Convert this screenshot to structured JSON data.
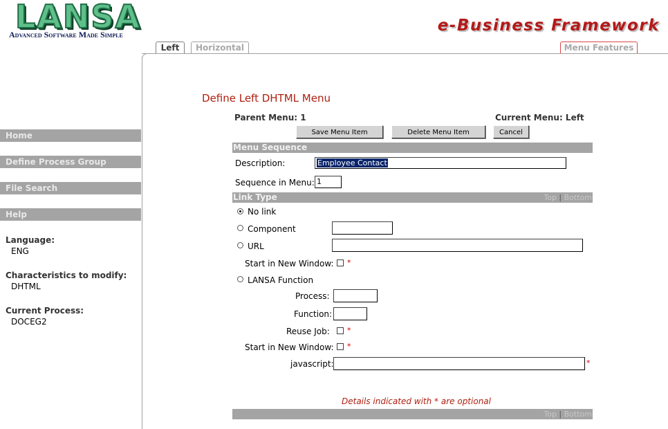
{
  "header": {
    "logo_text": "LANSA",
    "logo_tagline": "Advanced Software Made Simple",
    "brand": "e-Business Framework"
  },
  "tabs": [
    {
      "label": "Left",
      "active": true
    },
    {
      "label": "Horizontal",
      "active": false
    }
  ],
  "menu_features_tab": "Menu Features",
  "sidebar": {
    "nav": [
      "Home",
      "Define Process Group",
      "File Search",
      "Help"
    ],
    "language_label": "Language:",
    "language_value": "ENG",
    "characteristics_label": "Characteristics to modify:",
    "characteristics_value": "DHTML",
    "process_label": "Current Process:",
    "process_value": "DOCEG2"
  },
  "main": {
    "title": "Define Left DHTML Menu",
    "parent_menu": "Parent Menu: 1",
    "current_menu": "Current Menu: Left",
    "buttons": {
      "save": "Save Menu Item",
      "delete": "Delete Menu Item",
      "cancel": "Cancel"
    },
    "menu_sequence": {
      "header": "Menu Sequence",
      "description_label": "Description:",
      "description_value": "Employee Contact",
      "sequence_label": "Sequence in Menu:",
      "sequence_value": "1"
    },
    "link_type": {
      "header": "Link Type",
      "top": "Top",
      "sep": "|",
      "bottom": "Bottom",
      "no_link": "No link",
      "component": "Component",
      "url": "URL",
      "new_window": "Start in New Window:",
      "lansa_function": "LANSA Function",
      "process": "Process:",
      "function": "Function:",
      "reuse_job": "Reuse Job:",
      "new_window2": "Start in New Window:",
      "javascript": "javascript:",
      "star": "*",
      "selected": "No link"
    },
    "note": "Details indicated with * are optional",
    "footer": {
      "top": "Top",
      "sep": "|",
      "bottom": "Bottom"
    }
  }
}
